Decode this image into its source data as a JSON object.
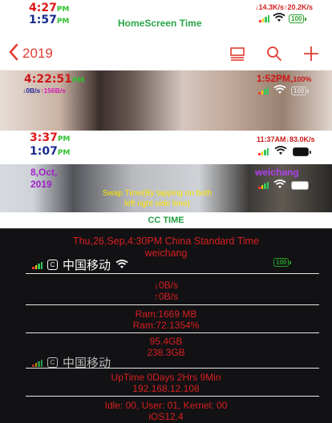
{
  "homescreen": {
    "time1": "4:27",
    "time1_ampm": "PM",
    "time2": "1:57",
    "time2_ampm": "PM",
    "title": "HomeScreen Time",
    "net_speed": "↓14.3K/s↑20.2K/s",
    "battery": "100"
  },
  "nav": {
    "back_label": "2019",
    "back_icon": "chevron-left-icon",
    "icons": [
      "layout-icon",
      "search-icon",
      "add-icon"
    ],
    "accent_color": "#e03c32"
  },
  "lockscreen": {
    "time": "4:22:51",
    "time_ampm": "PM",
    "speed_down": "↓0B/s",
    "speed_up": "↑156B/s",
    "right_time": "1:52PM,",
    "right_percent": "100%",
    "battery": "100"
  },
  "strip": {
    "time1": "3:37",
    "time1_ampm": "PM",
    "time2": "1:07",
    "time2_ampm": "PM",
    "right_info": "11:37AM↓83.0K/s"
  },
  "date_strip": {
    "date_line1": "8,Oct,",
    "date_line2": "2019",
    "user": "weichang",
    "swap_text": "Swap Time(By tapping on both left right side time)"
  },
  "cc": {
    "label": "CC TIME",
    "datetime": "Thu,26,Sep,4:30PM China Standard Time",
    "user": "weichang",
    "carrier": "中国移动",
    "carrier_icon": "C",
    "battery": "100",
    "down": "↓0B/s",
    "up": "↑0B/s",
    "ram1": "Ram:1669 MB",
    "ram2": "Ram:72.1354%",
    "disk1": "95.4GB",
    "disk2": "238.3GB",
    "carrier2": "中国移动",
    "uptime": "UpTime 0Days 2Hrs 9Min",
    "ip": "192.168.12.108",
    "cpu": "Idle: 00, User: 01, Kernel: 00",
    "ios": "iOS12.4"
  }
}
